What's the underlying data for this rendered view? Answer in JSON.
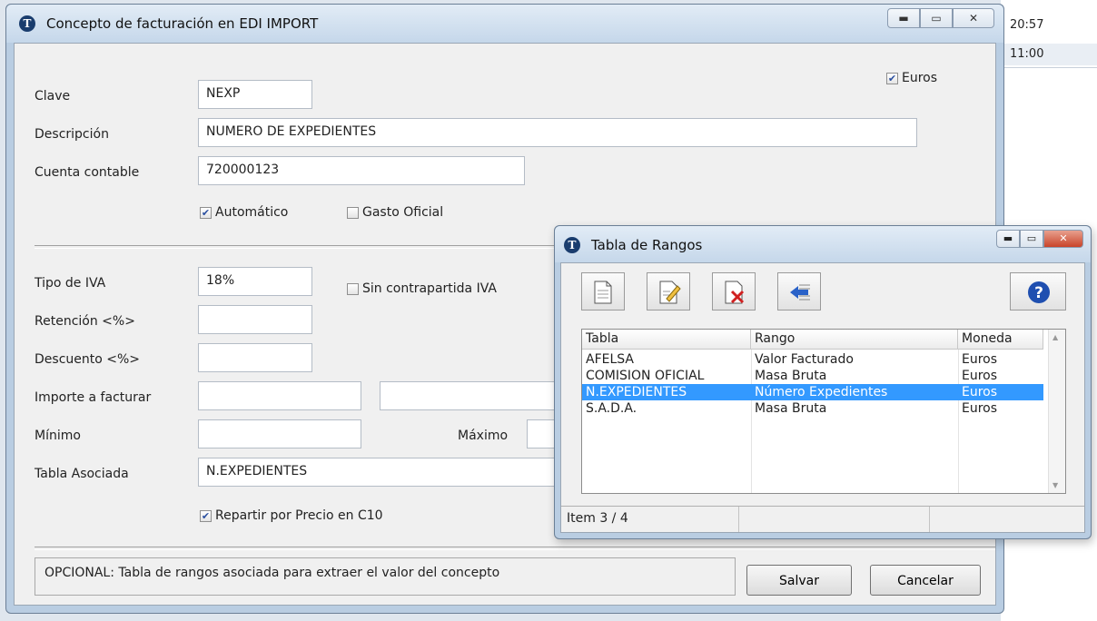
{
  "background": {
    "times": [
      "20:57",
      "11:00"
    ]
  },
  "main_window": {
    "title": "Concepto de facturación en EDI IMPORT",
    "form": {
      "euros_label": "Euros",
      "clave_label": "Clave",
      "clave_value": "NEXP",
      "descripcion_label": "Descripción",
      "descripcion_value": "NUMERO DE EXPEDIENTES",
      "cuenta_label": "Cuenta contable",
      "cuenta_value": "720000123",
      "automatico_label": "Automático",
      "gasto_label": "Gasto Oficial",
      "tipo_iva_label": "Tipo de IVA",
      "tipo_iva_value": "18%",
      "sin_contrapartida_label": "Sin contrapartida IVA",
      "retencion_label": "Retención <%>",
      "descuento_label": "Descuento <%>",
      "importe_label": "Importe a facturar",
      "minimo_label": "Mínimo",
      "maximo_label": "Máximo",
      "tabla_label": "Tabla Asociada",
      "tabla_value": "N.EXPEDIENTES",
      "repartir_label": "Repartir por Precio en C10"
    },
    "checks": {
      "euros": true,
      "automatico": true,
      "gasto_oficial": false,
      "sin_contrapartida": false,
      "repartir": true
    },
    "status_text": "OPCIONAL: Tabla de rangos asociada para extraer el valor del concepto",
    "buttons": {
      "save": "Salvar",
      "cancel": "Cancelar"
    }
  },
  "dialog": {
    "title": "Tabla de Rangos",
    "columns": [
      "Tabla",
      "Rango",
      "Moneda"
    ],
    "rows": [
      [
        "AFELSA",
        "Valor Facturado",
        "Euros"
      ],
      [
        "COMISION OFICIAL",
        "Masa Bruta",
        "Euros"
      ],
      [
        "N.EXPEDIENTES",
        "Número Expedientes",
        "Euros"
      ],
      [
        "S.A.D.A.",
        "Masa Bruta",
        "Euros"
      ]
    ],
    "selected_row": 2,
    "status": "Item 3 / 4"
  },
  "icons": [
    "app-icon",
    "new-document-icon",
    "edit-document-icon",
    "delete-document-icon",
    "back-arrow-icon",
    "help-icon",
    "check-icon"
  ]
}
